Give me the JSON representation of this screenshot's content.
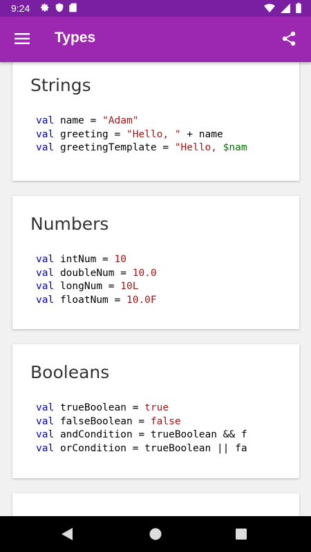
{
  "status_bar": {
    "time": "9:24",
    "icons_left": [
      "gear-icon",
      "shield-icon",
      "sd-card-icon"
    ],
    "icons_right": [
      "wifi-icon",
      "signal-icon",
      "battery-icon"
    ]
  },
  "app_bar": {
    "title": "Types",
    "menu_icon": "hamburger-icon",
    "share_icon": "share-icon",
    "color": "#9c27b0"
  },
  "cards": [
    {
      "title": "Strings",
      "lines": [
        {
          "kw": "val",
          "name": "name",
          "op": " = ",
          "parts": [
            {
              "t": "str",
              "v": "\"Adam\""
            }
          ]
        },
        {
          "kw": "val",
          "name": "greeting",
          "op": " = ",
          "parts": [
            {
              "t": "str",
              "v": "\"Hello, \""
            },
            {
              "t": "plain",
              "v": " + name"
            }
          ]
        },
        {
          "kw": "val",
          "name": "greetingTemplate",
          "op": " = ",
          "parts": [
            {
              "t": "str",
              "v": "\"Hello, "
            },
            {
              "t": "var",
              "v": "$nam"
            }
          ]
        }
      ]
    },
    {
      "title": "Numbers",
      "lines": [
        {
          "kw": "val",
          "name": "intNum",
          "op": " = ",
          "parts": [
            {
              "t": "num",
              "v": "10"
            }
          ]
        },
        {
          "kw": "val",
          "name": "doubleNum",
          "op": " = ",
          "parts": [
            {
              "t": "num",
              "v": "10.0"
            }
          ]
        },
        {
          "kw": "val",
          "name": "longNum",
          "op": " = ",
          "parts": [
            {
              "t": "num",
              "v": "10L"
            }
          ]
        },
        {
          "kw": "val",
          "name": "floatNum",
          "op": " = ",
          "parts": [
            {
              "t": "num",
              "v": "10.0F"
            }
          ]
        }
      ]
    },
    {
      "title": "Booleans",
      "lines": [
        {
          "kw": "val",
          "name": "trueBoolean",
          "op": " = ",
          "parts": [
            {
              "t": "str",
              "v": "true"
            }
          ]
        },
        {
          "kw": "val",
          "name": "falseBoolean",
          "op": " = ",
          "parts": [
            {
              "t": "str",
              "v": "false"
            }
          ]
        },
        {
          "kw": "val",
          "name": "andCondition",
          "op": " = ",
          "parts": [
            {
              "t": "plain",
              "v": "trueBoolean && f"
            }
          ]
        },
        {
          "kw": "val",
          "name": "orCondition",
          "op": " = ",
          "parts": [
            {
              "t": "plain",
              "v": "trueBoolean || fa"
            }
          ]
        }
      ]
    },
    {
      "title": "",
      "lines": []
    }
  ],
  "nav_bar": {
    "back_icon": "back-triangle-icon",
    "home_icon": "home-circle-icon",
    "recent_icon": "recents-square-icon"
  }
}
